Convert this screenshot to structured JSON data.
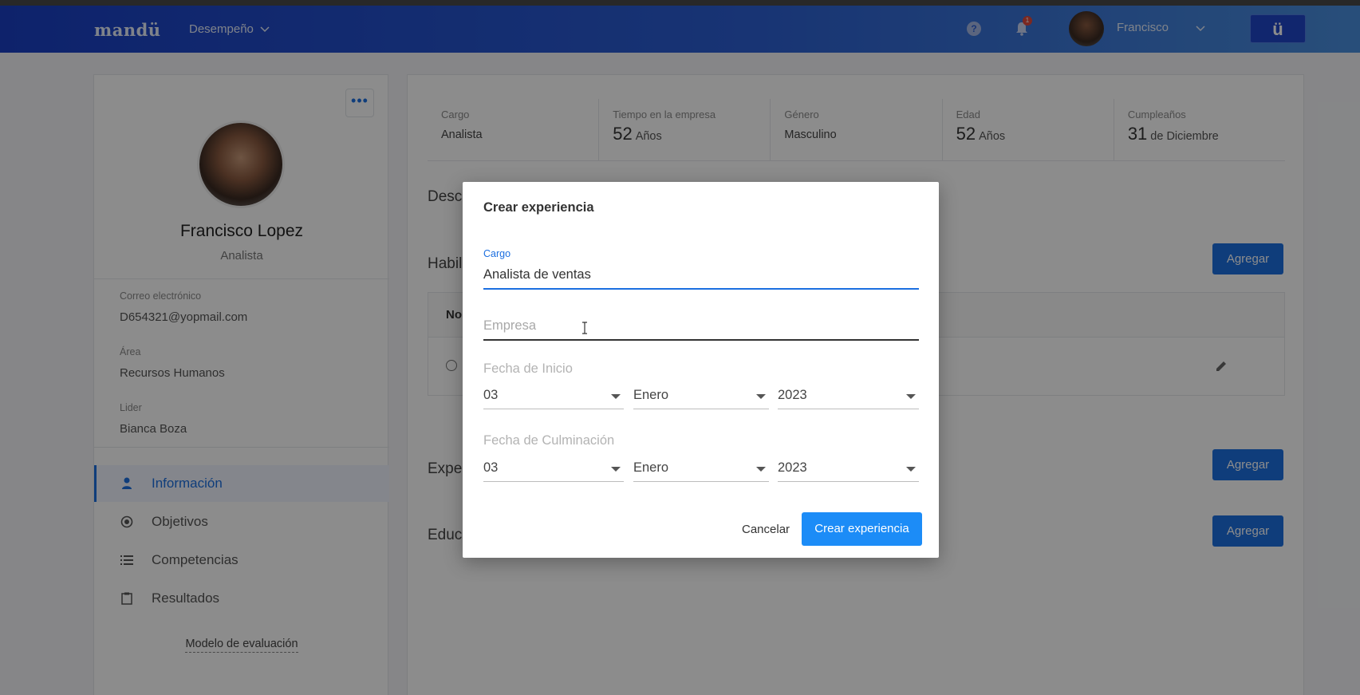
{
  "navbar": {
    "logo": "mandü",
    "menu_label": "Desempeño",
    "help_symbol": "?",
    "notification_count": "1",
    "user_name": "Francisco",
    "brand_symbol": "ü"
  },
  "profile": {
    "more_symbol": "•••",
    "name": "Francisco Lopez",
    "role": "Analista",
    "fields": [
      {
        "label": "Correo electrónico",
        "value": "D654321@yopmail.com"
      },
      {
        "label": "Área",
        "value": "Recursos Humanos"
      },
      {
        "label": "Lider",
        "value": "Bianca Boza"
      }
    ],
    "nav": [
      {
        "label": "Información",
        "icon": "person-icon",
        "active": true
      },
      {
        "label": "Objetivos",
        "icon": "target-icon",
        "active": false
      },
      {
        "label": "Competencias",
        "icon": "list-icon",
        "active": false
      },
      {
        "label": "Resultados",
        "icon": "clipboard-icon",
        "active": false
      }
    ],
    "eval_link": "Modelo de evaluación"
  },
  "stats": [
    {
      "label": "Cargo",
      "value": "Analista",
      "unit": ""
    },
    {
      "label": "Tiempo en la empresa",
      "value": "52",
      "unit": "Años"
    },
    {
      "label": "Género",
      "value": "Masculino",
      "unit": ""
    },
    {
      "label": "Edad",
      "value": "52",
      "unit": "Años"
    },
    {
      "label": "Cumpleaños",
      "value": "31",
      "unit": "de Diciembre"
    }
  ],
  "sections": {
    "descripcion": "Desc",
    "habilidades": "Habil",
    "experiencia": "Exper",
    "educacion": "Educ",
    "table_header": "No",
    "add_label": "Agregar"
  },
  "modal": {
    "title": "Crear experiencia",
    "cargo_label": "Cargo",
    "cargo_value": "Analista de ventas",
    "empresa_placeholder": "Empresa",
    "inicio_label": "Fecha de Inicio",
    "culminacion_label": "Fecha de Culminación",
    "inicio": {
      "day": "03",
      "month": "Enero",
      "year": "2023"
    },
    "culminacion": {
      "day": "03",
      "month": "Enero",
      "year": "2023"
    },
    "cancel_label": "Cancelar",
    "create_label": "Crear experiencia"
  },
  "colors": {
    "accent": "#1c6fe0",
    "navbar_start": "#1a3fc4",
    "navbar_end": "#4a8fde",
    "primary_button": "#1c8cf7"
  }
}
